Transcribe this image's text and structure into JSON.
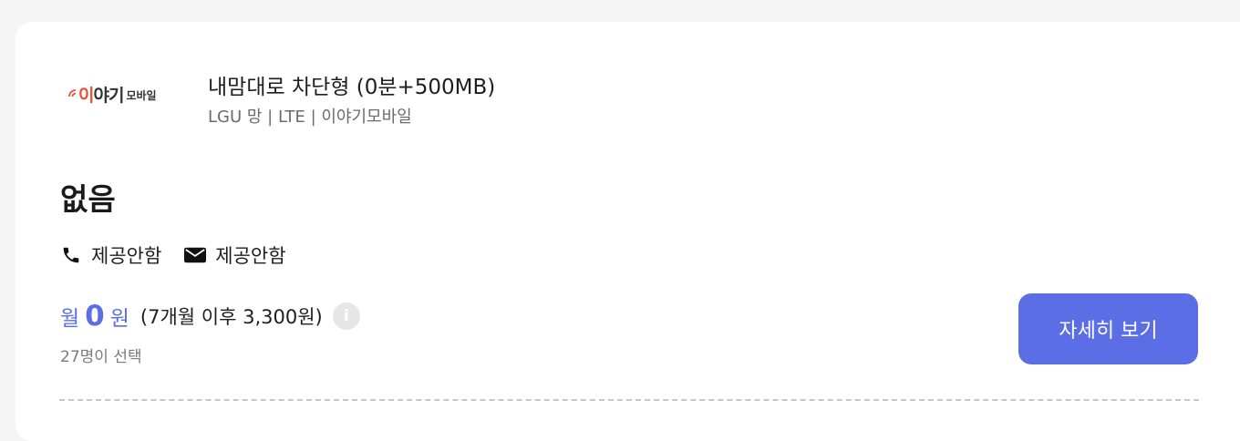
{
  "plan": {
    "logo": {
      "brand_prefix": "이",
      "brand_rest": "야기",
      "brand_sub": "모바일"
    },
    "title": "내맘대로 차단형 (0분+500MB)",
    "subtitle": "LGU 망 | LTE | 이야기모바일",
    "data_amount": "없음",
    "features": [
      {
        "icon": "phone-icon",
        "label": "제공안함"
      },
      {
        "icon": "mail-icon",
        "label": "제공안함"
      }
    ],
    "price": {
      "prefix": "월",
      "value": "0",
      "suffix": "원",
      "after_note": "(7개월 이후 3,300원)",
      "info_icon": "info-icon"
    },
    "selected_count": "27명이 선택",
    "detail_button": "자세히 보기"
  },
  "colors": {
    "accent": "#5c6ee6",
    "brand_red": "#e8503a",
    "text": "#1e1e1e",
    "muted": "#6b6b6b"
  }
}
